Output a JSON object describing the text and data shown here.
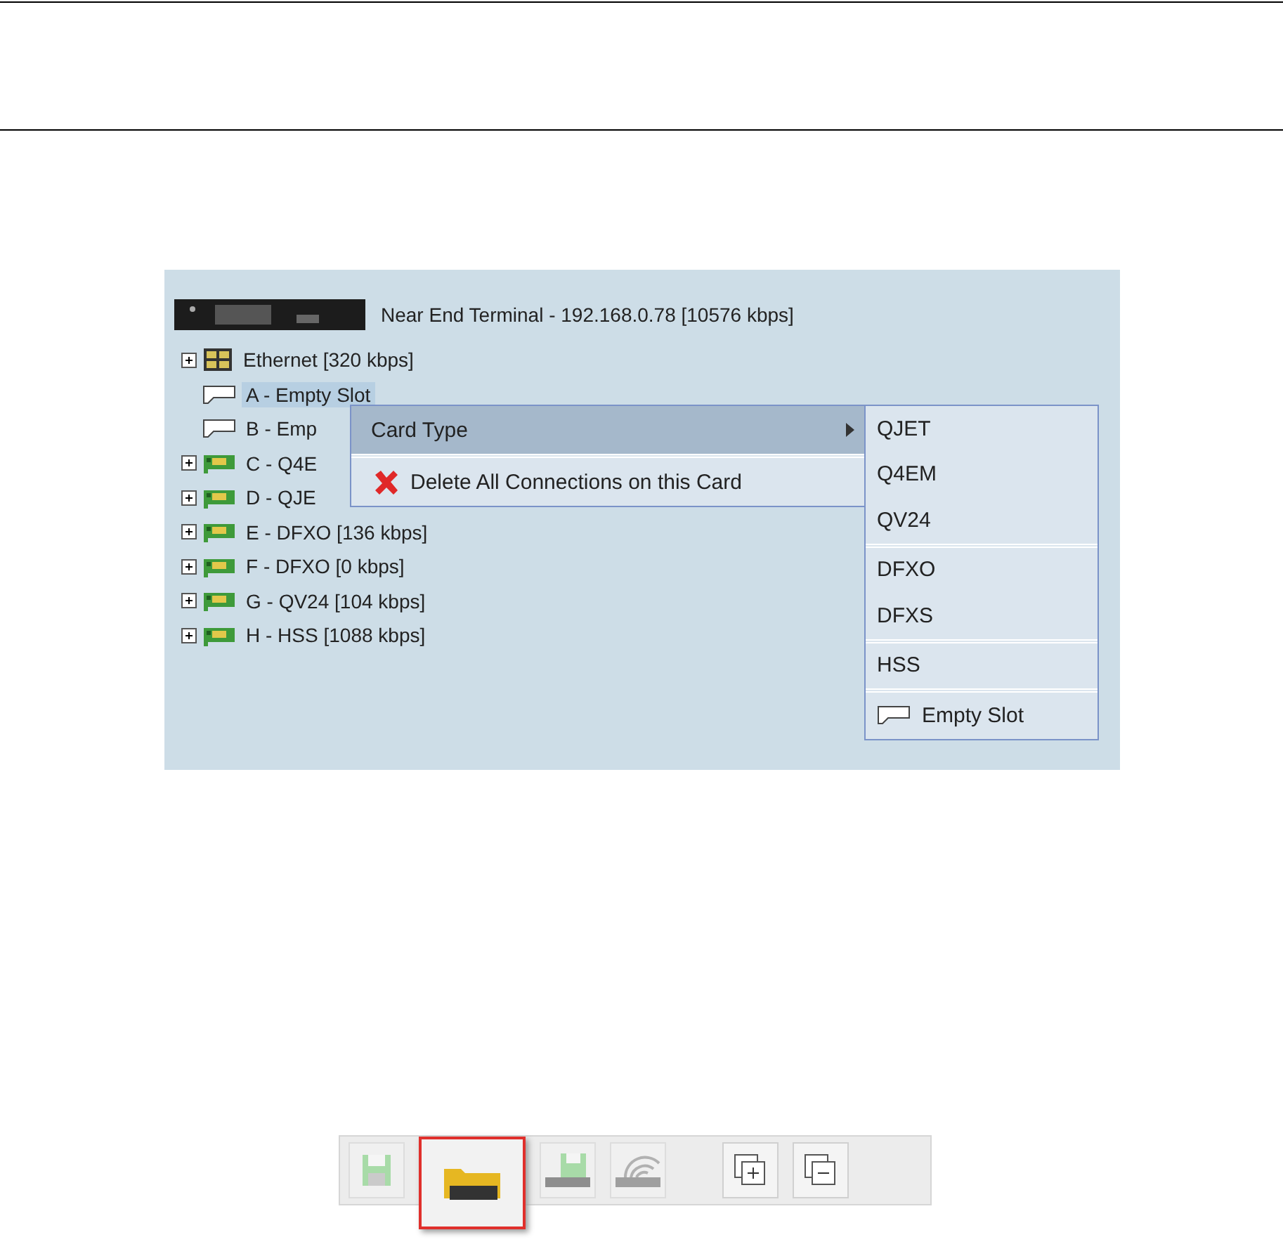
{
  "tree": {
    "root": {
      "label": "Near End Terminal - 192.168.0.78 [10576 kbps]"
    },
    "items": [
      {
        "kind": "ethernet",
        "label": "Ethernet [320 kbps]",
        "expanded": false,
        "selected": false
      },
      {
        "kind": "empty",
        "label": "A - Empty Slot",
        "selected": true
      },
      {
        "kind": "empty",
        "label": "B - Emp",
        "selected": false
      },
      {
        "kind": "card",
        "label": "C - Q4E",
        "expanded": false,
        "selected": false
      },
      {
        "kind": "card",
        "label": "D - QJE",
        "expanded": false,
        "selected": false
      },
      {
        "kind": "card",
        "label": "E - DFXO [136 kbps]",
        "expanded": false,
        "selected": false
      },
      {
        "kind": "card",
        "label": "F - DFXO [0 kbps]",
        "expanded": false,
        "selected": false
      },
      {
        "kind": "card",
        "label": "G - QV24 [104 kbps]",
        "expanded": false,
        "selected": false
      },
      {
        "kind": "card",
        "label": "H - HSS [1088 kbps]",
        "expanded": false,
        "selected": false
      }
    ]
  },
  "context_menu": {
    "items": [
      {
        "kind": "submenu",
        "label": "Card Type",
        "selected": true
      },
      {
        "kind": "delete",
        "label": "Delete All Connections on this Card",
        "selected": false
      }
    ]
  },
  "submenu": {
    "groups": [
      [
        {
          "label": "QJET"
        },
        {
          "label": "Q4EM"
        },
        {
          "label": "QV24"
        }
      ],
      [
        {
          "label": "DFXO"
        },
        {
          "label": "DFXS"
        }
      ],
      [
        {
          "label": "HSS"
        }
      ],
      [
        {
          "label": "Empty Slot",
          "kind": "empty"
        }
      ]
    ]
  },
  "toolbar": {
    "buttons": [
      {
        "kind": "save",
        "disabled": true,
        "highlighted": false
      },
      {
        "kind": "open",
        "disabled": false,
        "highlighted": true
      },
      {
        "kind": "download",
        "disabled": true,
        "highlighted": false
      },
      {
        "kind": "wireless",
        "disabled": true,
        "highlighted": false
      },
      {
        "kind": "expand",
        "disabled": false,
        "highlighted": false
      },
      {
        "kind": "collapse",
        "disabled": false,
        "highlighted": false
      }
    ]
  }
}
